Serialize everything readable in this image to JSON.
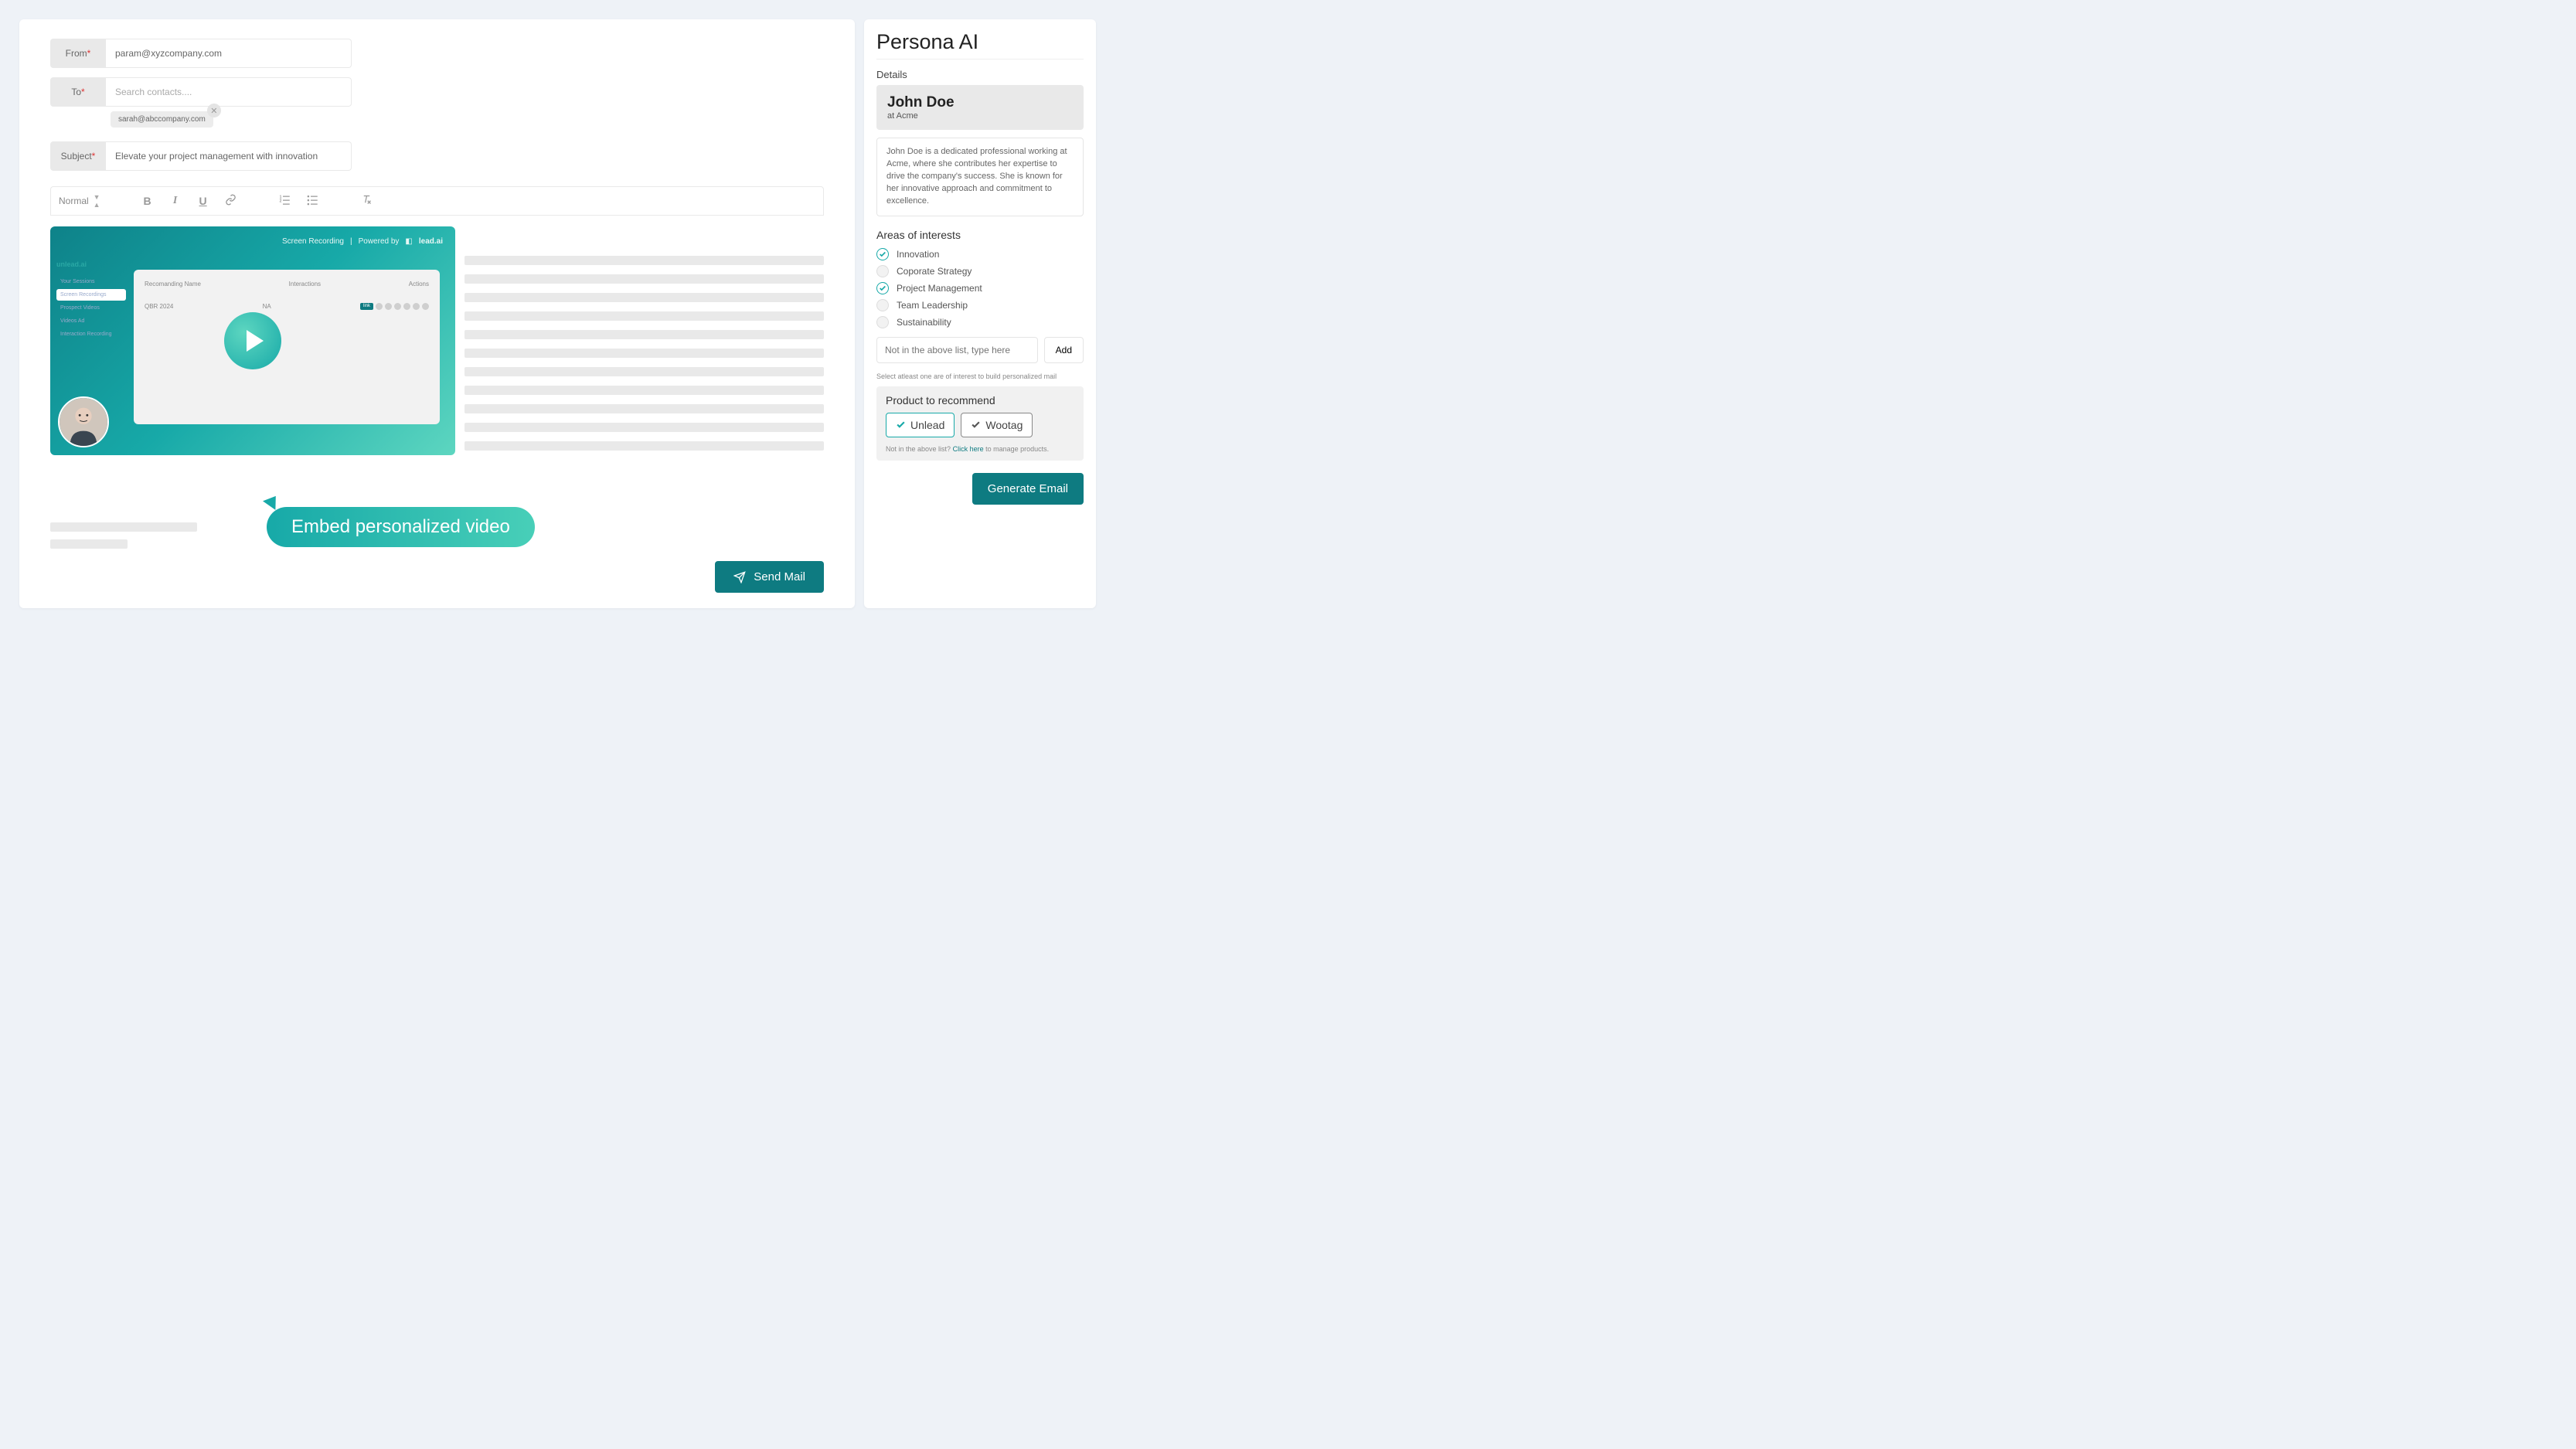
{
  "compose": {
    "from_label": "From",
    "from_value": "param@xyzcompany.com",
    "to_label": "To",
    "to_placeholder": "Search contacts....",
    "to_chips": [
      {
        "email": "sarah@abccompany.com"
      }
    ],
    "subject_label": "Subject",
    "subject_value": "Elevate your project management with innovation",
    "toolbar": {
      "style": "Normal"
    },
    "video": {
      "head_left": "Screen Recording",
      "head_sep": "|",
      "head_right": "Powered by",
      "brand": "lead.ai",
      "sidebar_logo": "unlead.ai",
      "sidebar_items": [
        "Your Sessions",
        "Screen Recordings",
        "Prospect Videos",
        "Videos Ad",
        "Interaction Recording"
      ],
      "table_headers": [
        "Recomanding Name",
        "Interactions",
        "Actions"
      ],
      "table_row": {
        "name": "QBR 2024",
        "interactions": "NA",
        "tag": "link"
      }
    },
    "callout": "Embed personalized video",
    "send_label": "Send Mail"
  },
  "persona": {
    "title": "Persona AI",
    "details_label": "Details",
    "name": "John Doe",
    "org_prefix": "at",
    "org": "Acme",
    "description": "John Doe is a dedicated professional working at Acme, where she contributes her expertise to drive the company's success. She is known for her innovative approach and commitment to excellence.",
    "interests_title": "Areas of interests",
    "interests": [
      {
        "label": "Innovation",
        "checked": true
      },
      {
        "label": "Coporate Strategy",
        "checked": false
      },
      {
        "label": "Project Management",
        "checked": true
      },
      {
        "label": "Team Leadership",
        "checked": false
      },
      {
        "label": "Sustainability",
        "checked": false
      }
    ],
    "add_placeholder": "Not in the above list, type here",
    "add_label": "Add",
    "hint": "Select atleast one are of interest to build personalized mail",
    "products_title": "Product to recommend",
    "products": [
      {
        "label": "Unlead",
        "primary": true
      },
      {
        "label": "Wootag",
        "primary": false
      }
    ],
    "manage_prefix": "Not in the above list?",
    "manage_link": "Click here",
    "manage_suffix": "to manage products.",
    "generate_label": "Generate Email"
  }
}
